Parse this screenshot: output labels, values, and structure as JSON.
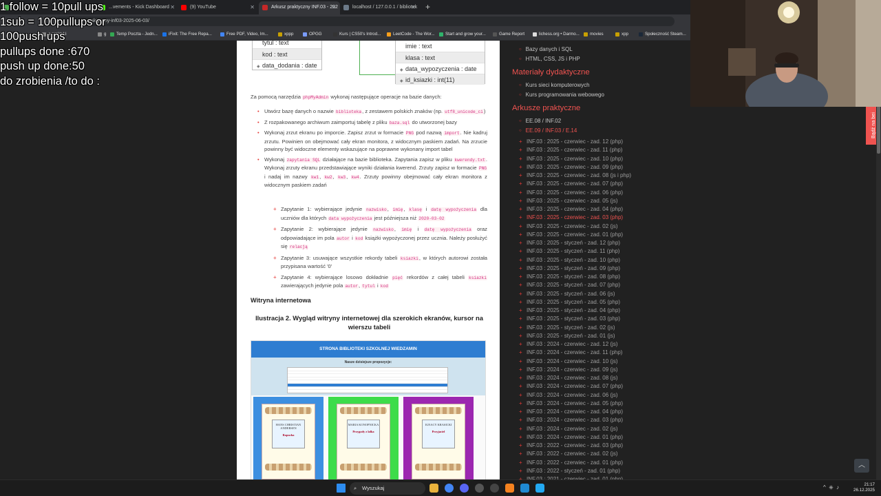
{
  "tabs": [
    {
      "label": "",
      "color": "#4caf50"
    },
    {
      "label": "...vements - Kick Dashboard",
      "color": "#53fc18"
    },
    {
      "label": "(9) YouTube",
      "color": "#ff0000"
    },
    {
      "label": "Arkusz praktyczny INF.03 - 202",
      "color": "#c62828"
    },
    {
      "label": "localhost / 127.0.0.1 / bibliotek",
      "color": "#6c7a89"
    }
  ],
  "address": {
    "url": "...praktyczny-inf03-2025-06-03/"
  },
  "bookmarks": [
    "e praktyki",
    "g",
    "Temp Poczta - Jedn...",
    "iFixit: The Free Repa...",
    "Free PDF, Video, Im...",
    "xppp",
    "OPGG",
    "Kurs | CS50's Introd...",
    "LeetCode - The Wor...",
    "Start and grow your...",
    "Game Report",
    "lichess.org • Darmo...",
    "movies",
    "xpp",
    "Społeczność Steam...",
    "now"
  ],
  "overlay": [
    "1 follow = 10pull ups",
    "1sub = 100pullups or",
    "100push ups",
    "pullups done :670",
    "push up done:50",
    "do zrobienia /to do :"
  ],
  "diagram": {
    "left": [
      "tytul : text",
      "kod : text",
      "data_dodania : date"
    ],
    "right": [
      "imie : text",
      "klasa : text",
      "data_wypozyczenia : date",
      "id_ksiazki : int(11)"
    ]
  },
  "doc": {
    "intro_a": "Za pomocą narzędzia ",
    "intro_code": "phpMyAdmin",
    "intro_b": " wykonaj następujące operacje na bazie danych:",
    "b1a": "Utwórz bazę danych o nazwie ",
    "b1c": "biblioteka",
    "b1b": ", z zestawem polskich znaków (np. ",
    "b1d": "utf8_unicode_ci",
    "b1e": ")",
    "b2a": "Z rozpakowanego archiwum zaimportuj tabelę z pliku ",
    "b2c": "baza.sql",
    "b2b": " do utworzonej bazy",
    "b3a": "Wykonaj zrzut ekranu po imporcie. Zapisz zrzut w formacie ",
    "b3c": "PNG",
    "b3b": " pod nazwą ",
    "b3d": "import",
    "b3e": ". Nie kadruj zrzutu. Powinien on obejmować cały ekran monitora, z widocznym paskiem zadań. Na zrzucie powinny być widoczne elementy wskazujące na poprawne wykonany import tabel",
    "b4a": "Wykonaj ",
    "b4c": "zapytania SQL",
    "b4b": " działające na bazie biblioteka. Zapytania zapisz w pliku ",
    "b4d": "kwerendy.txt",
    "b4e": ". Wykonaj zrzuty ekranu przedstawiające wyniki działania kwerend. Zrzuty zapisz w formacie ",
    "b4f": "PNG",
    "b4g": " i nadaj im nazwy ",
    "b4h": "kw1",
    "b4i": "kw2",
    "b4j": "kw3",
    "b4k": "kw4",
    "b4l": ". Zrzuty powinny obejmować cały ekran monitora z widocznym paskiem zadań",
    "q1a": "Zapytanie 1: wybierające jedynie ",
    "q1b": "nazwisko",
    "q1c": "imię",
    "q1d": "klasę",
    "q1e": "datę wypożyczenia",
    "q1f": " dla uczniów dla których ",
    "q1g": "data wypożyczenia",
    "q1h": " jest późniejsza niż ",
    "q1i": "2020-03-02",
    "q2a": "Zapytanie 2: wybierające jedynie ",
    "q2b": "nazwisko",
    "q2c": "imię",
    "q2d": "datę wypożyczenia",
    "q2e": " oraz odpowiadające im pola ",
    "q2f": "autor",
    "q2g": "kod",
    "q2h": " książki wypożyczonej przez ucznia. Należy posłużyć się ",
    "q2i": "relacją",
    "q3a": "Zapytanie 3: usuwające wszystkie rekordy tabeli ",
    "q3b": "ksiazki",
    "q3c": ", w których autorowi została przypisana wartość '0'",
    "q4a": "Zapytanie 4: wybierające losowo dokładnie ",
    "q4b": "pięć",
    "q4c": " rekordów z całej tabeli ",
    "q4d": "ksiazki",
    "q4e": " zawierających jedynie pola ",
    "q4f": "autor",
    "q4g": "tytul",
    "q4h": "kod",
    "section": "Witryna internetowa",
    "caption": "Ilustracja 2. Wygląd witryny internetowej dla szerokich ekranów, kursor na wierszu tabeli",
    "ill_header": "STRONA BIBLIOTEKI SZKOLNEJ WIEDZAMIN",
    "ill_sub": "Nasze dzisiejsze propozycje:",
    "books": [
      {
        "author": "HANS CHRISTIAN ANDERSEN",
        "title": "Ropucha",
        "bg": "#3d8fe0"
      },
      {
        "author": "MARIA KONOPNICKA",
        "title": "Przygody z lalka",
        "bg": "#3ddc4a"
      },
      {
        "author": "IGNACY KRASICKI",
        "title": "Przyjaciel",
        "bg": "#9c27b0"
      }
    ]
  },
  "sidebar": {
    "top_links": [
      "Bazy danych i SQL",
      "HTML, CSS, JS i PHP"
    ],
    "h1": "Materiały dydaktyczne",
    "courses": [
      "Kurs sieci komputerowych",
      "Kurs programowania webowego"
    ],
    "h2": "Arkusze praktyczne",
    "exams": [
      "EE.08 / INF.02",
      "EE.09 / INF.03 / E.14"
    ],
    "arkusze": [
      "INF.03 : 2025 - czerwiec - zad. 12 (php)",
      "INF.03 : 2025 - czerwiec - zad. 11 (php)",
      "INF.03 : 2025 - czerwiec - zad. 10 (php)",
      "INF.03 : 2025 - czerwiec - zad. 09 (php)",
      "INF.03 : 2025 - czerwiec - zad. 08 (js i php)",
      "INF.03 : 2025 - czerwiec - zad. 07 (php)",
      "INF.03 : 2025 - czerwiec - zad. 06 (php)",
      "INF.03 : 2025 - czerwiec - zad. 05 (js)",
      "INF.03 : 2025 - czerwiec - zad. 04 (php)",
      "INF.03 : 2025 - czerwiec - zad. 03 (php)",
      "INF.03 : 2025 - czerwiec - zad. 02 (js)",
      "INF.03 : 2025 - czerwiec - zad. 01 (php)",
      "INF.03 : 2025 - styczeń - zad. 12 (php)",
      "INF.03 : 2025 - styczeń - zad. 11 (php)",
      "INF.03 : 2025 - styczeń - zad. 10 (php)",
      "INF.03 : 2025 - styczeń - zad. 09 (php)",
      "INF.03 : 2025 - styczeń - zad. 08 (php)",
      "INF.03 : 2025 - styczeń - zad. 07 (php)",
      "INF.03 : 2025 - styczeń - zad. 06 (js)",
      "INF.03 : 2025 - styczeń - zad. 05 (php)",
      "INF.03 : 2025 - styczeń - zad. 04 (php)",
      "INF.03 : 2025 - styczeń - zad. 03 (php)",
      "INF.03 : 2025 - styczeń - zad. 02 (js)",
      "INF.03 : 2025 - styczeń - zad. 01 (js)",
      "INF.03 : 2024 - czerwiec - zad. 12 (js)",
      "INF.03 : 2024 - czerwiec - zad. 11 (php)",
      "INF.03 : 2024 - czerwiec - zad. 10 (js)",
      "INF.03 : 2024 - czerwiec - zad. 09 (js)",
      "INF.03 : 2024 - czerwiec - zad. 08 (js)",
      "INF.03 : 2024 - czerwiec - zad. 07 (php)",
      "INF.03 : 2024 - czerwiec - zad. 06 (js)",
      "INF.03 : 2024 - czerwiec - zad. 05 (php)",
      "INF.03 : 2024 - czerwiec - zad. 04 (php)",
      "INF.03 : 2024 - czerwiec - zad. 03 (php)",
      "INF.03 : 2024 - czerwiec - zad. 02 (js)",
      "INF.03 : 2024 - czerwiec - zad. 01 (php)",
      "INF.03 : 2022 - czerwiec - zad. 03 (php)",
      "INF.03 : 2022 - czerwiec - zad. 02 (js)",
      "INF.03 : 2022 - czerwiec - zad. 01 (php)",
      "INF.03 : 2022 - styczeń - zad. 01 (php)",
      "INF.03 : 2021 - czerwiec - zad. 01 (php)"
    ],
    "active_index": 9,
    "donate": "Bądź na bei"
  },
  "taskbar": {
    "search": "Wyszukaj",
    "time": "21:17",
    "date": "26.12.2025"
  }
}
